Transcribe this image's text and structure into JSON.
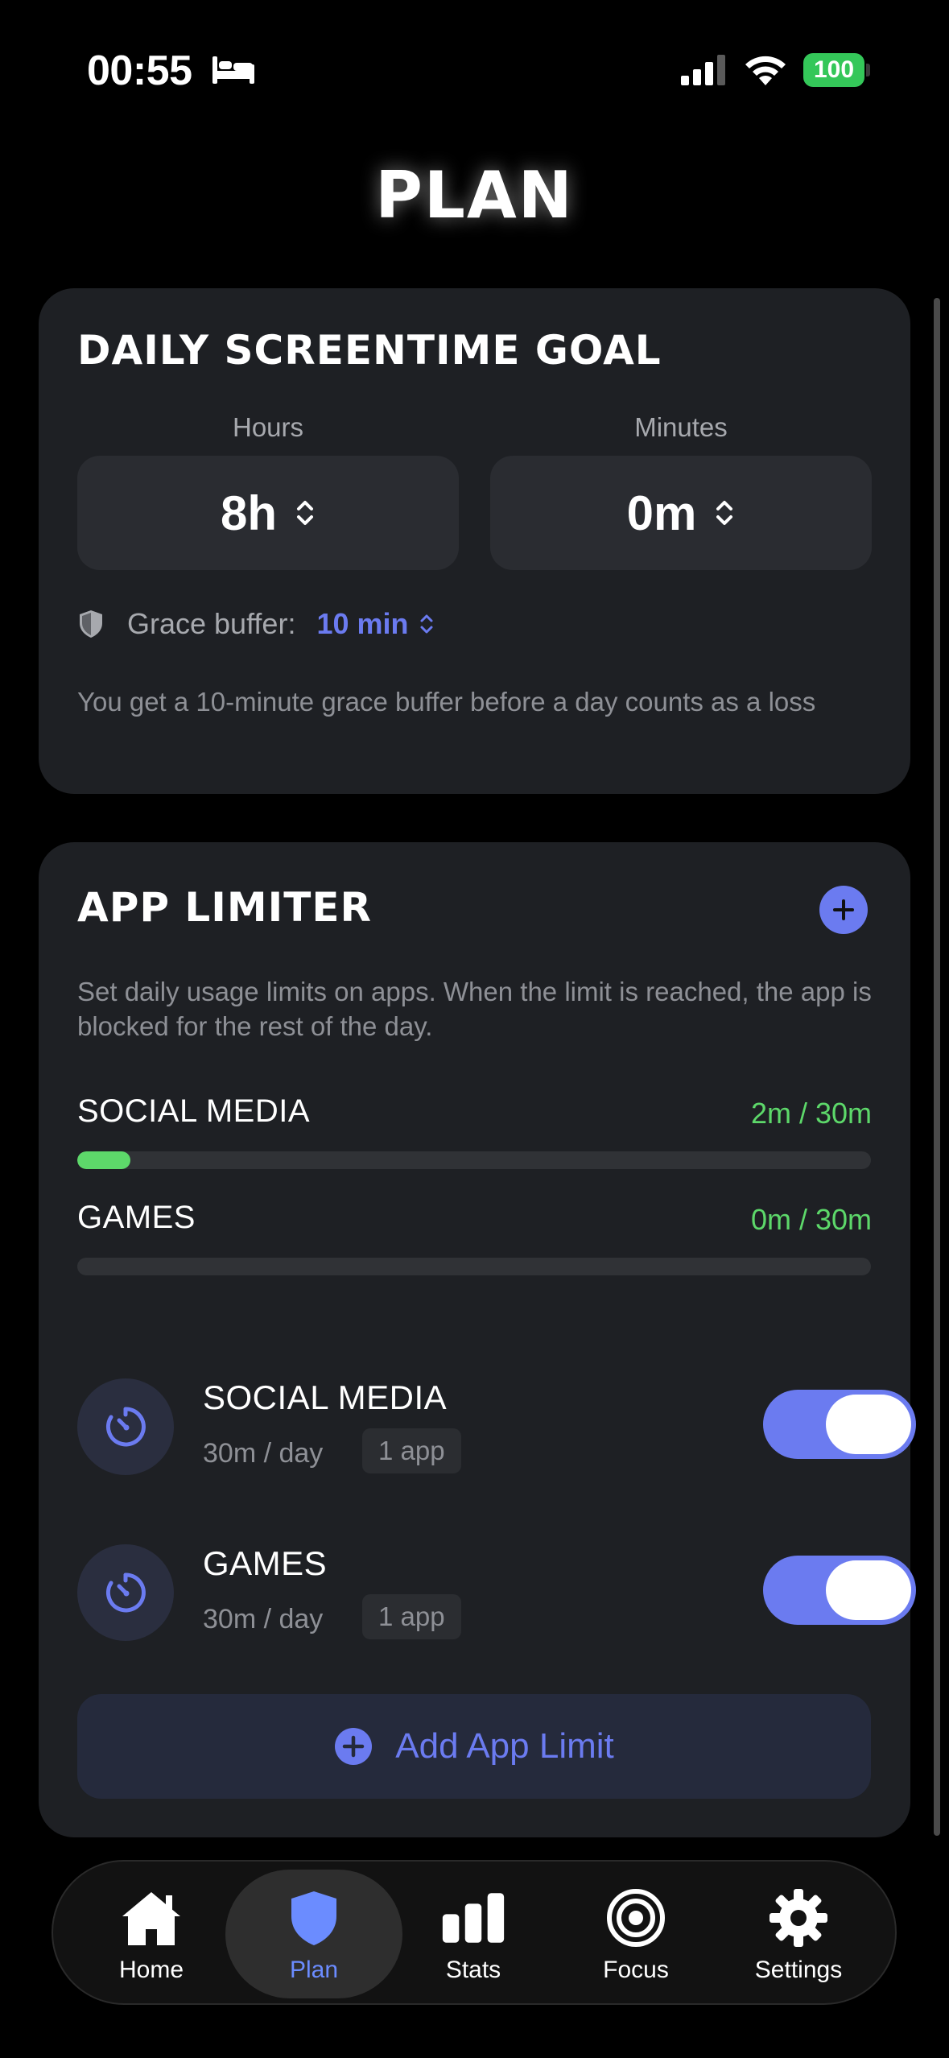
{
  "status_bar": {
    "time": "00:55",
    "battery": "100"
  },
  "page": {
    "title": "PLAN"
  },
  "goal_card": {
    "heading": "DAILY SCREENTIME GOAL",
    "hours_label": "Hours",
    "hours_value": "8h",
    "minutes_label": "Minutes",
    "minutes_value": "0m",
    "grace_label": "Grace buffer:",
    "grace_value": "10 min",
    "note": "You get a 10-minute grace buffer before a day counts as a loss"
  },
  "limiter_card": {
    "heading": "APP LIMITER",
    "description": "Set daily usage limits on apps. When the limit is reached, the app is blocked for the rest of the day.",
    "usage": [
      {
        "name": "SOCIAL MEDIA",
        "amount": "2m / 30m",
        "progress": 0.067
      },
      {
        "name": "GAMES",
        "amount": "0m / 30m",
        "progress": 0
      }
    ],
    "limits": [
      {
        "name": "SOCIAL MEDIA",
        "per_day": "30m / day",
        "apps": "1 app",
        "enabled": true
      },
      {
        "name": "GAMES",
        "per_day": "30m / day",
        "apps": "1 app",
        "enabled": true
      }
    ],
    "add_button": "Add App Limit"
  },
  "tabbar": {
    "items": [
      {
        "label": "Home",
        "icon": "home-icon"
      },
      {
        "label": "Plan",
        "icon": "shield-icon",
        "active": true
      },
      {
        "label": "Stats",
        "icon": "stats-icon"
      },
      {
        "label": "Focus",
        "icon": "target-icon"
      },
      {
        "label": "Settings",
        "icon": "gear-icon"
      }
    ]
  },
  "colors": {
    "accent": "#6b7bf0",
    "success": "#5dd86a",
    "card": "#1e2024"
  }
}
